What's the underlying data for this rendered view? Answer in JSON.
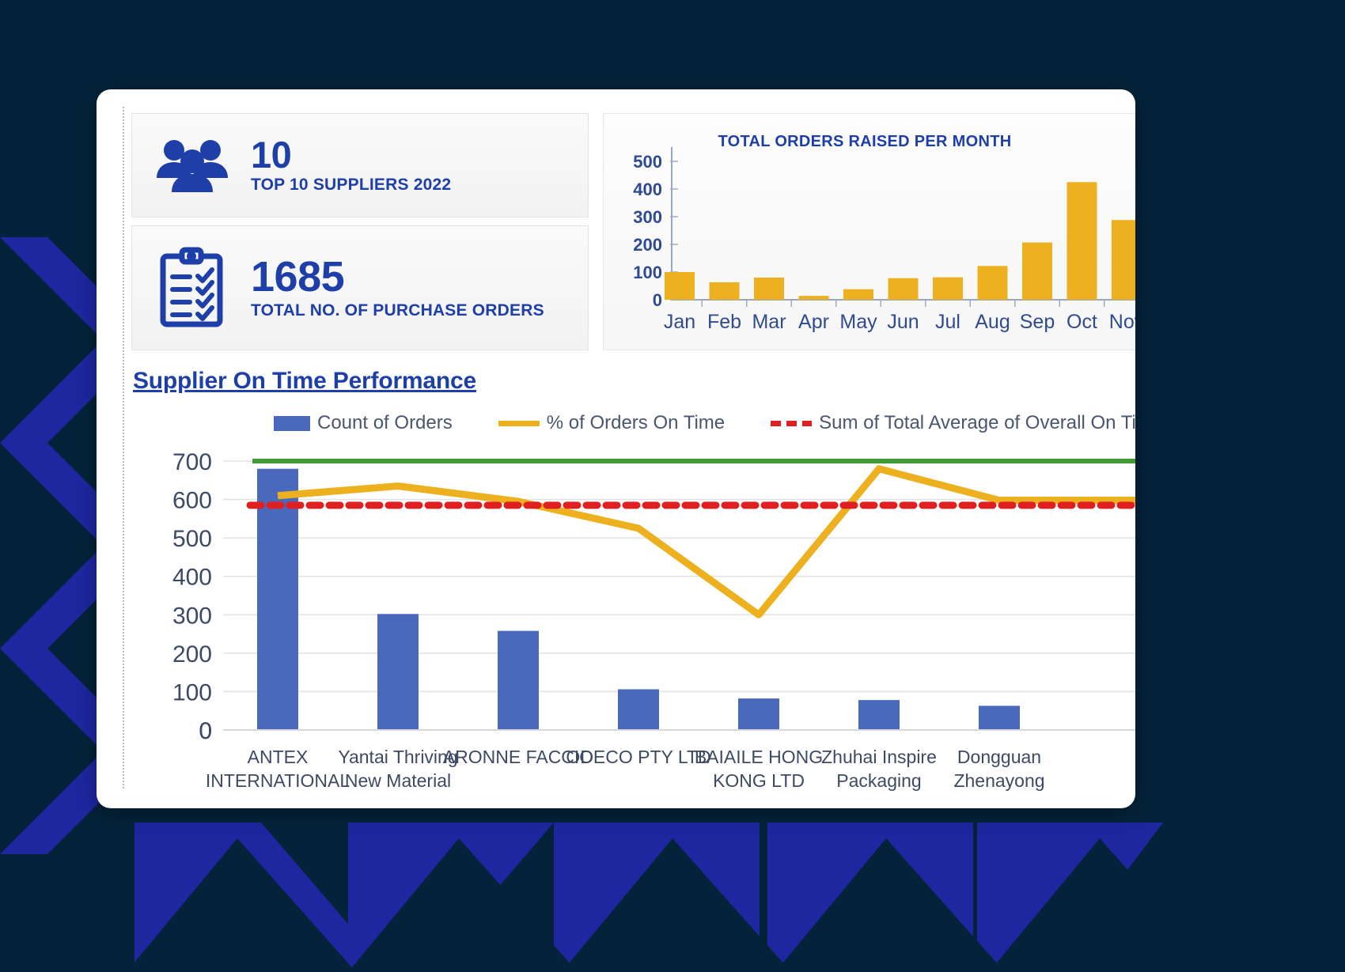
{
  "theme": {
    "page_bg": "#04233a",
    "pattern_blue": "#1f27a0",
    "card_bg": "#ffffff",
    "brand_blue": "#1e3fa8",
    "bar_blue": "#4a69bd",
    "bar_yellow": "#edb11f",
    "line_yellow": "#edb11f",
    "line_red": "#e02020",
    "line_green": "#3f9c35",
    "axis_text": "#3d4a63"
  },
  "kpi": [
    {
      "id": "top-suppliers",
      "icon": "people-icon",
      "value": "10",
      "label": "TOP 10 SUPPLIERS 2022"
    },
    {
      "id": "total-purchase-orders",
      "icon": "clipboard-checklist-icon",
      "value": "1685",
      "label": "TOTAL NO. OF PURCHASE ORDERS"
    }
  ],
  "supplier_section": {
    "title": "Supplier On Time Performance",
    "legend": [
      {
        "label": "Count of Orders",
        "marker": "bar",
        "color": "#4a69bd"
      },
      {
        "label": "% of Orders On Time",
        "marker": "line",
        "color": "#edb11f"
      },
      {
        "label": "Sum of Total Average of Overall On Time",
        "marker": "dashed-line",
        "color": "#e02020"
      }
    ]
  },
  "chart_data": [
    {
      "id": "total-orders-raised-per-month",
      "type": "bar",
      "title": "TOTAL ORDERS RAISED PER MONTH",
      "xlabel": "",
      "ylabel": "",
      "ylim": [
        0,
        500
      ],
      "yticks": [
        0,
        100,
        200,
        300,
        400,
        500
      ],
      "grid": false,
      "legend_position": "none",
      "categories": [
        "Jan",
        "Feb",
        "Mar",
        "Apr",
        "May",
        "Jun",
        "Jul",
        "Aug",
        "Sep",
        "Oct",
        "Nov"
      ],
      "values": [
        100,
        63,
        80,
        14,
        38,
        78,
        81,
        122,
        207,
        425,
        288
      ],
      "series_color": "#edb11f",
      "note": "Chart is horizontally clipped by the card edge after Nov"
    },
    {
      "id": "supplier-on-time-performance",
      "type": "bar",
      "title": "Supplier On Time Performance",
      "xlabel": "",
      "ylabel": "",
      "ylim": [
        0,
        700
      ],
      "yticks": [
        0,
        100,
        200,
        300,
        400,
        500,
        600,
        700
      ],
      "grid": true,
      "legend_position": "top",
      "categories": [
        "ANTEX INTERNATIONAL",
        "Yantai Thriving New Material",
        "ARONNE FACCIO",
        "ODECO PTY LTD",
        "BAIAILE HONG KONG LTD",
        "Zhuhai Inspire Packaging",
        "Dongguan Zhenayong"
      ],
      "series": [
        {
          "name": "Count of Orders",
          "type": "bar",
          "color": "#4a69bd",
          "values": [
            680,
            302,
            258,
            106,
            82,
            78,
            63
          ]
        },
        {
          "name": "% of Orders On Time",
          "type": "line",
          "color": "#edb11f",
          "values": [
            610,
            635,
            595,
            525,
            300,
            680,
            598
          ]
        },
        {
          "name": "Sum of Total Average of Overall On Time",
          "type": "dashed-line",
          "color": "#e02020",
          "constant": 585
        },
        {
          "name": "Overall reference line",
          "type": "line",
          "color": "#3f9c35",
          "constant": 700
        }
      ],
      "note": "Chart is horizontally clipped by the card edge after Dongguan Zhenayong"
    }
  ]
}
